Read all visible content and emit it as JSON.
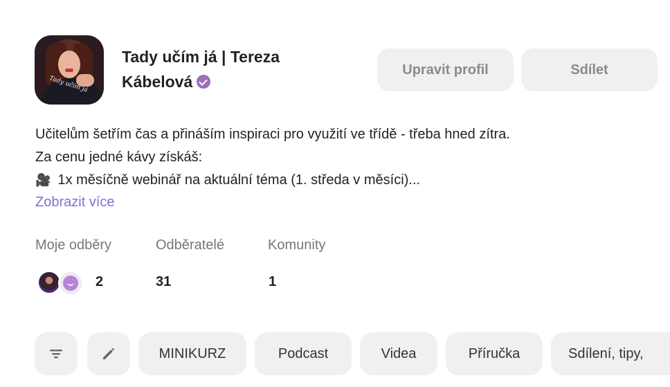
{
  "profile": {
    "name": "Tady učím já | Tereza Kábelová",
    "verified_icon": "verified-badge-icon",
    "avatar_shirt_text": "Tady učím já",
    "buttons": {
      "edit": "Upravit profil",
      "share": "Sdílet"
    },
    "bio_lines": [
      "Učitelům šetřím čas a přináším inspiraci pro využití ve třídě - třeba hned zítra.",
      "Za cenu jedné kávy získáš:",
      "1x měsíčně webinář na aktuální téma (1. středa v měsíci)..."
    ],
    "bio_line3_icon": "🎥",
    "show_more": "Zobrazit více"
  },
  "stats": {
    "subscriptions_label": "Moje odběry",
    "subscriptions_value": "2",
    "subscribers_label": "Odběratelé",
    "subscribers_value": "31",
    "communities_label": "Komunity",
    "communities_value": "1"
  },
  "chips": {
    "filter_icon": "filter-icon",
    "edit_icon": "pencil-icon",
    "items": [
      "MINIKURZ",
      "Podcast",
      "Videa",
      "Příručka",
      "Sdílení, tipy,"
    ]
  },
  "colors": {
    "accent_link": "#7b72d6",
    "verified": "#9c6fb8",
    "button_bg": "#f0f0f0"
  }
}
